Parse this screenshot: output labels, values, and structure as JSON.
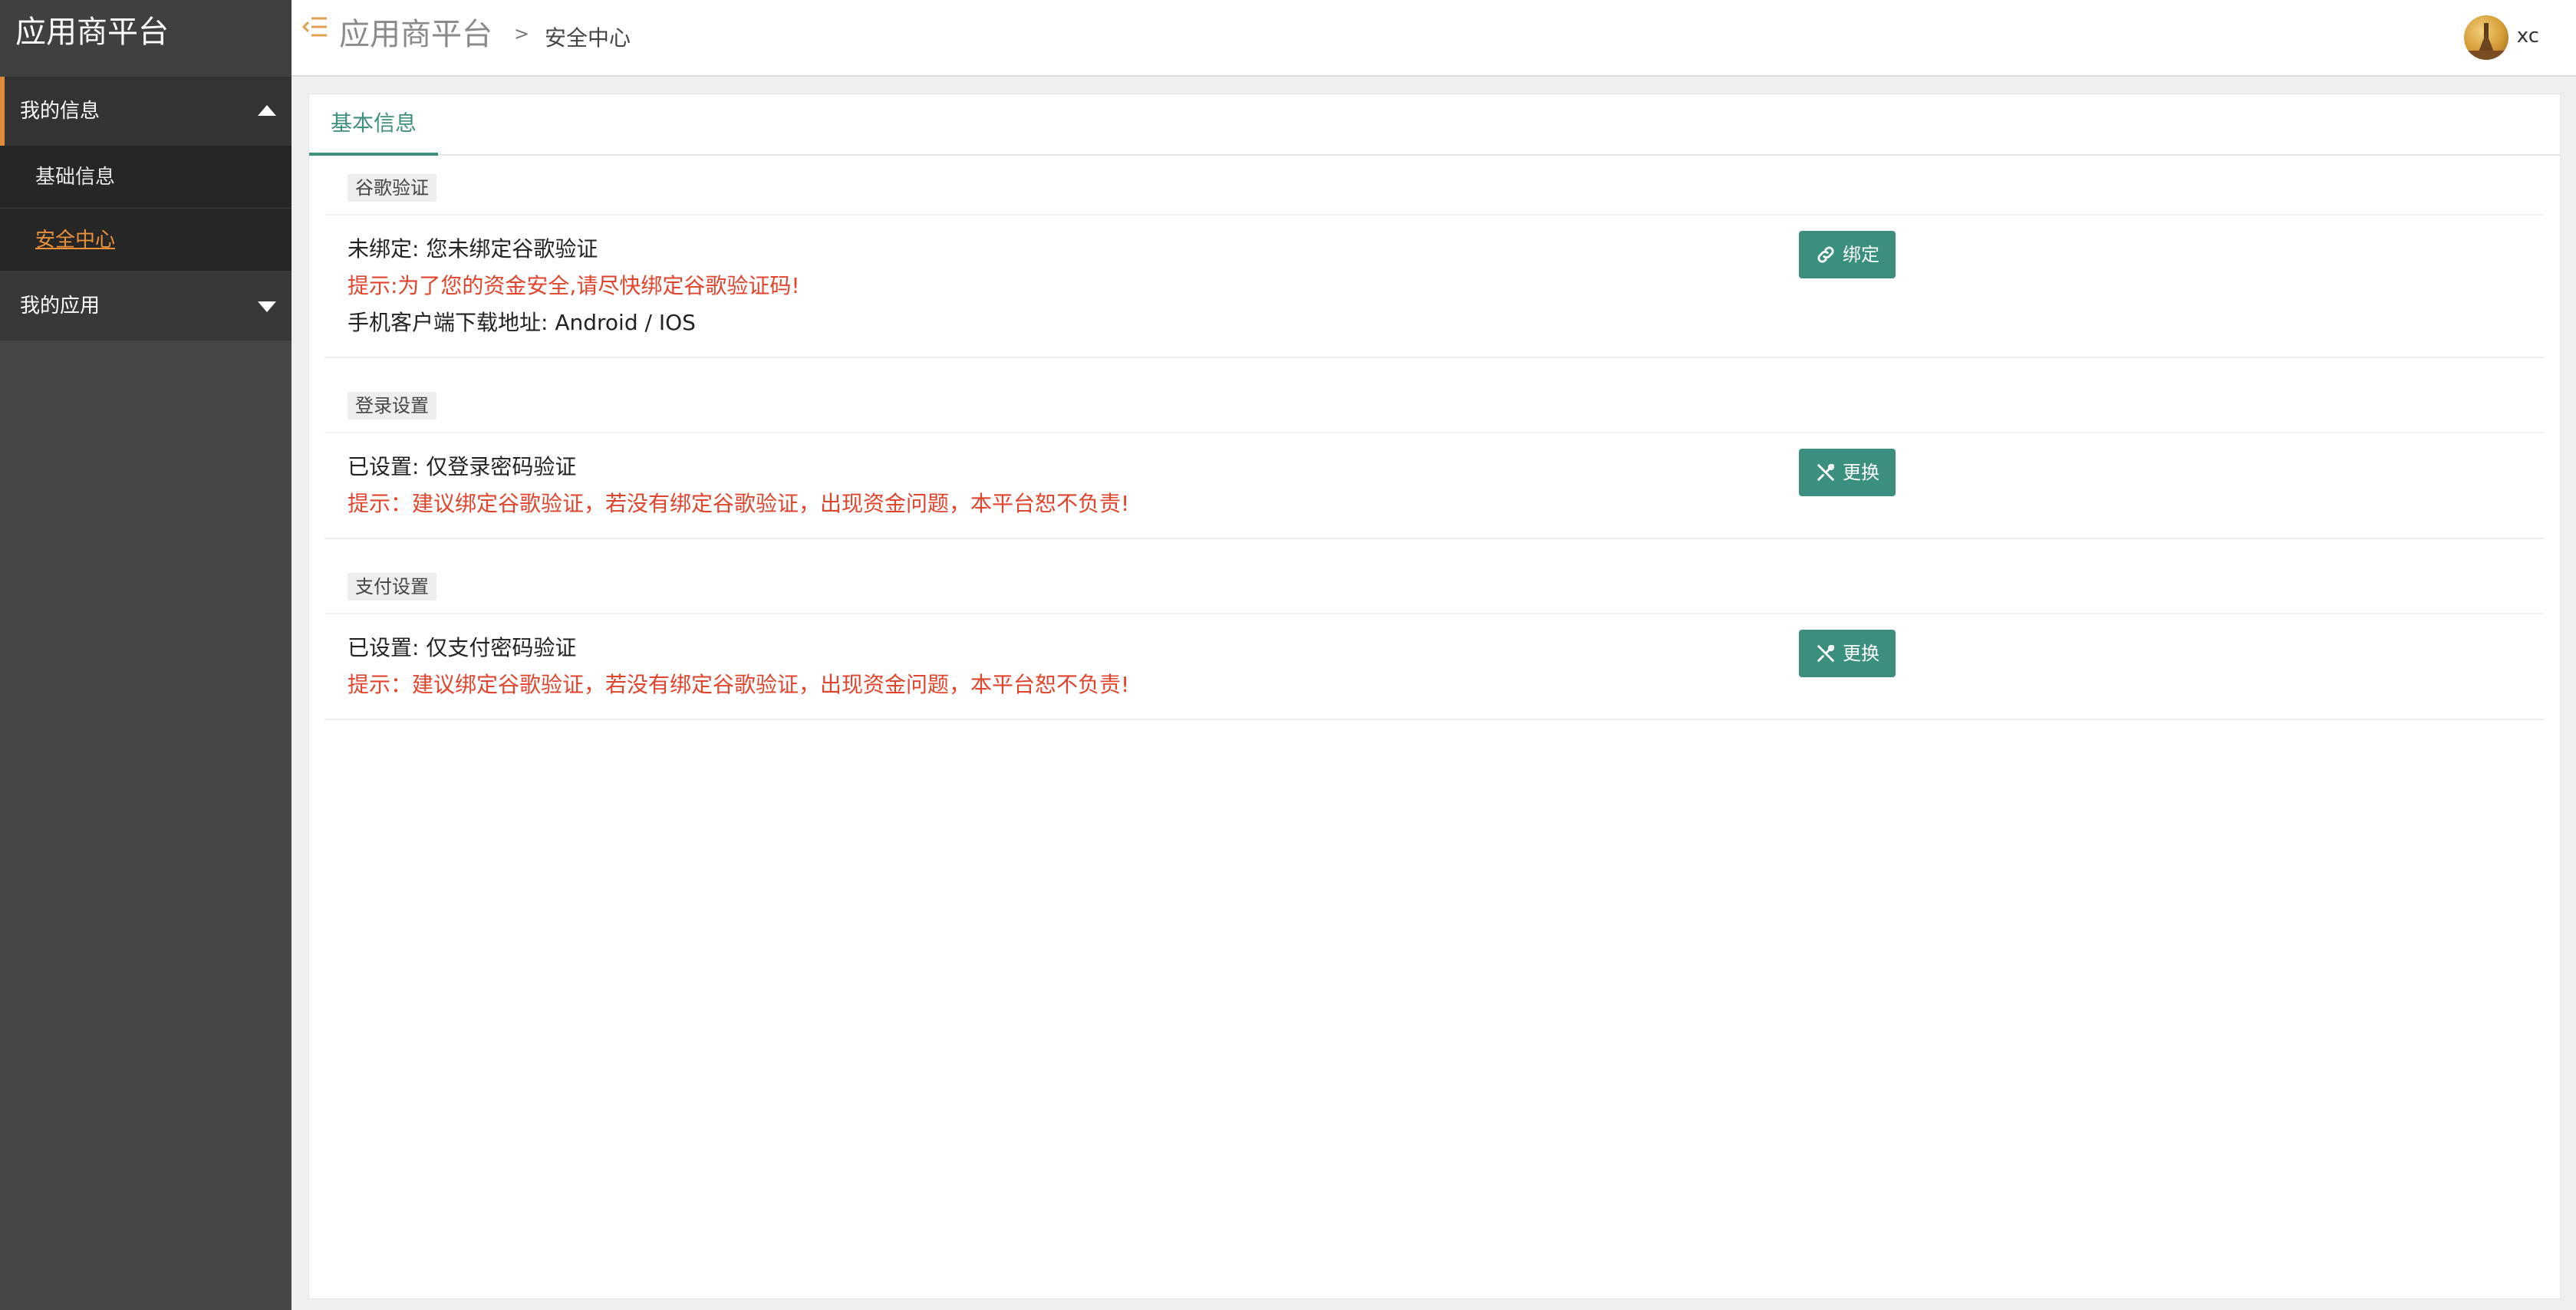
{
  "app": {
    "title": "应用商平台"
  },
  "sidebar": {
    "groups": [
      {
        "label": "我的信息",
        "expanded": true,
        "items": [
          {
            "label": "基础信息",
            "active": false
          },
          {
            "label": "安全中心",
            "active": true
          }
        ]
      },
      {
        "label": "我的应用",
        "expanded": false
      }
    ]
  },
  "header": {
    "title": "应用商平台",
    "breadcrumb_sep": ">",
    "breadcrumb_current": "安全中心",
    "username": "xc"
  },
  "tabs": [
    {
      "label": "基本信息",
      "active": true
    }
  ],
  "sections": [
    {
      "tag": "谷歌验证",
      "lines": [
        {
          "text": "未绑定: 您未绑定谷歌验证",
          "warn": false
        },
        {
          "text": "提示:为了您的资金安全,请尽快绑定谷歌验证码!",
          "warn": true
        },
        {
          "text": "手机客户端下载地址: Android / IOS",
          "warn": false
        }
      ],
      "button": {
        "label": "绑定",
        "icon": "link-icon"
      }
    },
    {
      "tag": "登录设置",
      "lines": [
        {
          "text": "已设置: 仅登录密码验证",
          "warn": false
        },
        {
          "text": "提示：建议绑定谷歌验证，若没有绑定谷歌验证，出现资金问题，本平台恕不负责!",
          "warn": true
        }
      ],
      "button": {
        "label": "更换",
        "icon": "tools-icon"
      }
    },
    {
      "tag": "支付设置",
      "lines": [
        {
          "text": "已设置: 仅支付密码验证",
          "warn": false
        },
        {
          "text": "提示：建议绑定谷歌验证，若没有绑定谷歌验证，出现资金问题，本平台恕不负责!",
          "warn": true
        }
      ],
      "button": {
        "label": "更换",
        "icon": "tools-icon"
      }
    }
  ],
  "colors": {
    "accent": "#3a8f7e",
    "warn": "#e0442c",
    "sidebar_active": "#e8903a",
    "sidebar_bg": "#464646"
  }
}
